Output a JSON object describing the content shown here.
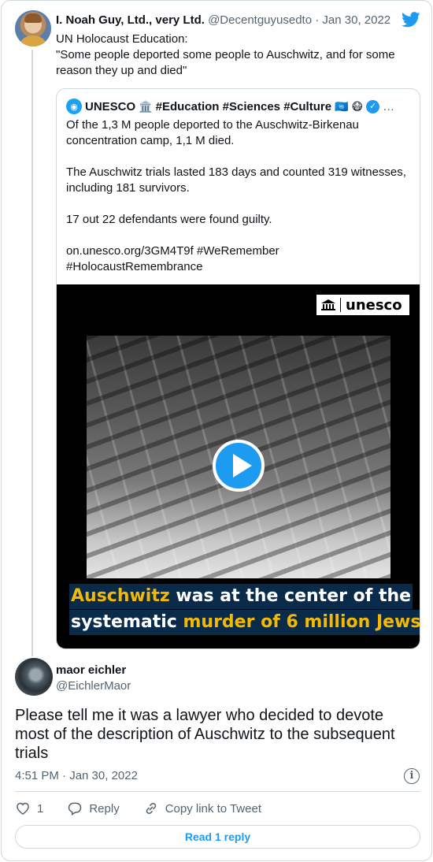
{
  "tweet": {
    "author_name": "I. Noah Guy, Ltd., very Ltd.",
    "author_handle": "@Decentguyusedto",
    "date": "Jan 30, 2022",
    "meta_sep": " · ",
    "text": "UN Holocaust Education:\n\"Some people deported some people to Auschwitz, and for some reason they up and died\""
  },
  "quoted": {
    "author_name": "UNESCO",
    "emoji_1": "🏛️",
    "hashtags": "#Education #Sciences #Culture",
    "emoji_2": "🇺🇳",
    "emoji_3": "😷",
    "verified_glyph": "✓",
    "more": "…",
    "text": "Of the 1,3 M people deported to the Auschwitz-Birkenau concentration camp, 1,1 M died.\n\nThe Auschwitz trials lasted 183 days and counted 319 witnesses, including 181 survivors.\n\n17 out 22 defendants were found guilty.\n\non.unesco.org/3GM4T9f #WeRemember #HolocaustRemembrance",
    "video": {
      "logo_text": "unesco",
      "caption_line1_yellow": "Auschwitz",
      "caption_line1_white": " was at the center of the",
      "caption_line2_white": "systematic ",
      "caption_line2_yellow": "murder of 6 million Jews"
    }
  },
  "reply": {
    "author_name": "maor eichler",
    "author_handle": "@EichlerMaor",
    "text": "Please tell me it was a lawyer who decided to devote most of the description of Auschwitz to the subsequent trials",
    "timestamp": "4:51 PM · Jan 30, 2022",
    "info_glyph": "i"
  },
  "actions": {
    "like_count": "1",
    "reply_label": "Reply",
    "copy_link_label": "Copy link to Tweet"
  },
  "read_replies_label": "Read 1 reply",
  "colors": {
    "accent": "#1d9bf0",
    "text": "#0f1419",
    "muted": "#536471",
    "border": "#cfd9de",
    "caption_yellow": "#f5b800",
    "caption_bg": "#0a2a4a"
  }
}
